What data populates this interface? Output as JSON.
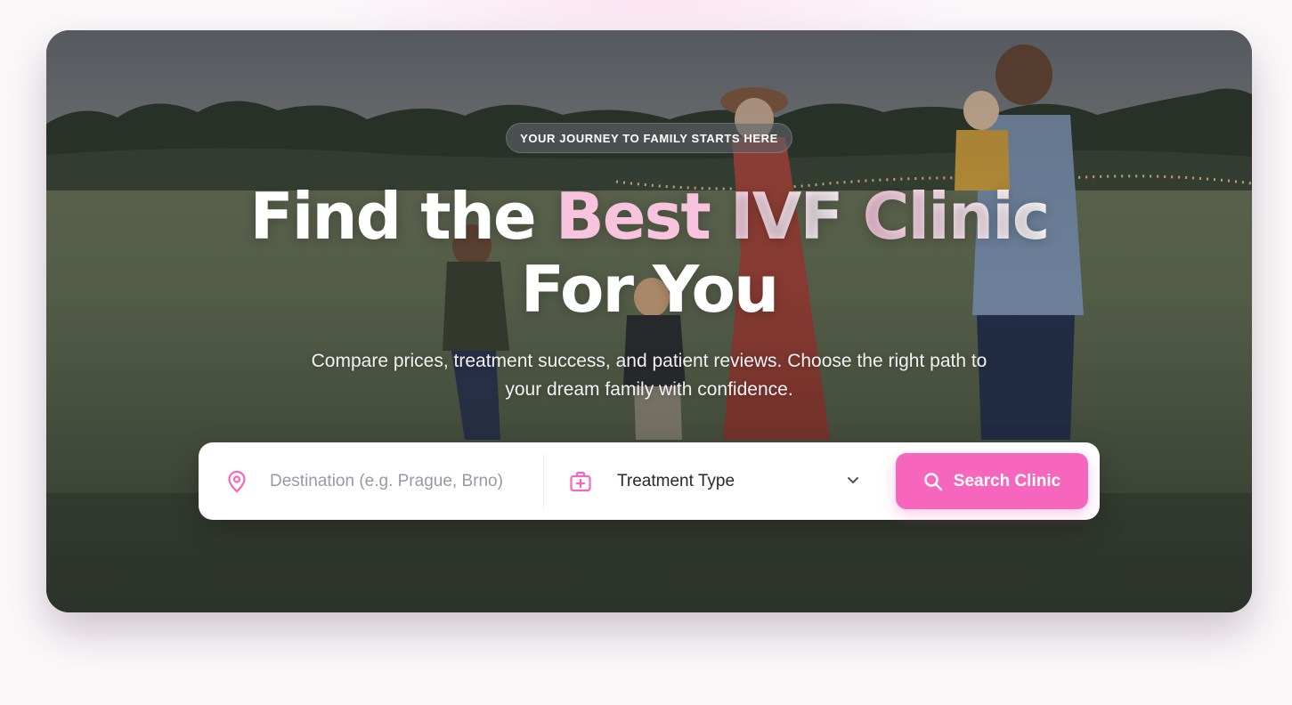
{
  "hero": {
    "badge": "YOUR JOURNEY TO FAMILY STARTS HERE",
    "headline": {
      "part1": "Find the ",
      "highlight": "Best",
      "part2": " IVF ",
      "fade": "Clinic",
      "line2": "For You"
    },
    "subtitle": "Compare prices, treatment success, and patient reviews. Choose the right path to your dream family with confidence."
  },
  "search": {
    "destination_placeholder": "Destination (e.g. Prague, Brno)",
    "destination_value": "",
    "treatment_selected": "Treatment Type",
    "button_label": "Search Clinic"
  },
  "icons": {
    "destination": "map-pin-icon",
    "treatment": "medical-kit-icon",
    "dropdown": "chevron-down-icon",
    "search": "search-icon"
  },
  "colors": {
    "accent_pink": "#f766bd",
    "headline_highlight": "#f8c3dc",
    "page_background": "#fbf8fa"
  }
}
